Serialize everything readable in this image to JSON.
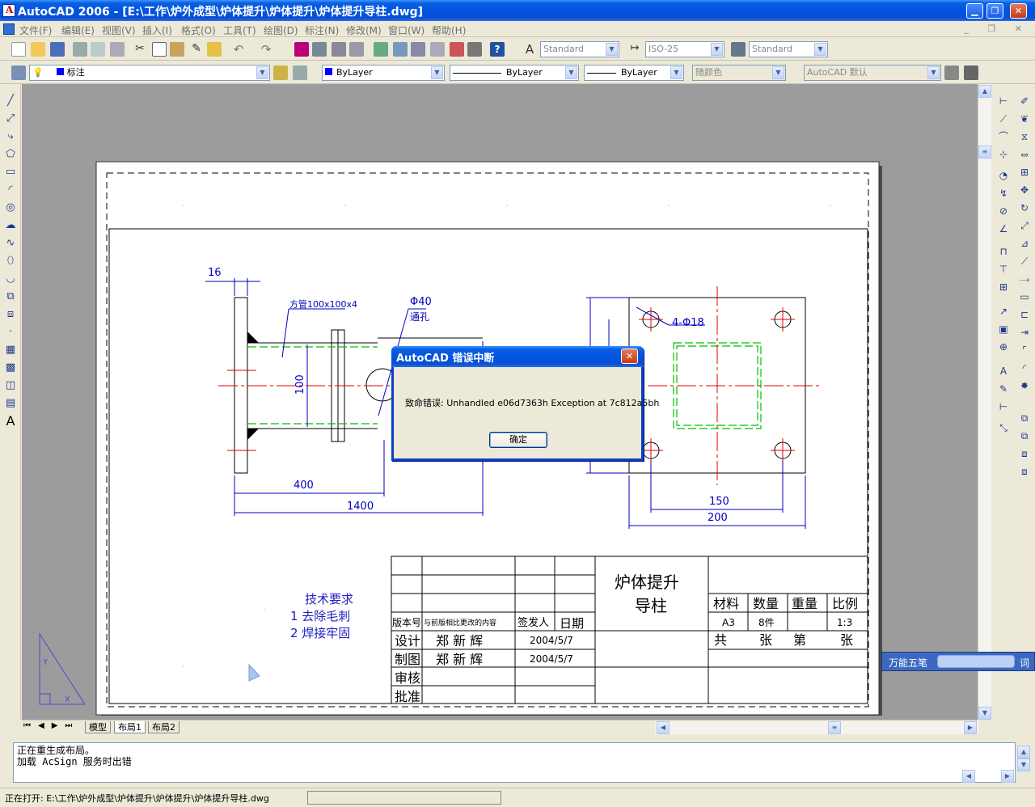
{
  "window": {
    "title": "AutoCAD 2006 - [E:\\工作\\炉外成型\\炉体提升\\炉体提升\\炉体提升导柱.dwg]",
    "controls": [
      "0",
      "1",
      "r"
    ]
  },
  "menu": [
    "文件(F)",
    "编辑(E)",
    "视图(V)",
    "插入(I)",
    "格式(O)",
    "工具(T)",
    "绘图(D)",
    "标注(N)",
    "修改(M)",
    "窗口(W)",
    "帮助(H)"
  ],
  "toolbar1": {
    "text_style": "Standard",
    "dim_style": "ISO-25",
    "table_style": "Standard"
  },
  "toolbar2": {
    "layer": "标注",
    "color": "ByLayer",
    "linetype": "ByLayer",
    "lineweight": "ByLayer",
    "plotstyle": "随颜色",
    "workspace": "AutoCAD 默认"
  },
  "drawing": {
    "dims": {
      "d16": "16",
      "pipe": "方管100x100x4",
      "phi40": "Φ40",
      "through": "通孔",
      "holes": "4-Φ18",
      "d100": "100",
      "d400": "400",
      "d1400": "1400",
      "d150": "150",
      "d200": "200"
    },
    "tech": {
      "title": "技术要求",
      "item1": "1 去除毛刺",
      "item2": "2 焊接牢固"
    },
    "titleblock": {
      "part_name_1": "炉体提升",
      "part_name_2": "导柱",
      "ver": "版本号",
      "changes": "与前版相比更改的内容",
      "issuer": "签发人",
      "date": "日期",
      "design": "设计",
      "draw": "制图",
      "check": "审核",
      "approve": "批准",
      "designer": "郑 新 辉",
      "drafter": "郑 新 辉",
      "date1": "2004/5/7",
      "date2": "2004/5/7",
      "material_h": "材料",
      "qty_h": "数量",
      "weight_h": "重量",
      "scale_h": "比例",
      "material": "A3",
      "qty": "8件",
      "scale": "1:3",
      "total": "共",
      "sheets": "张",
      "no": "第",
      "sheet2": "张"
    }
  },
  "dialog": {
    "title": "AutoCAD 错误中断",
    "message": "致命错误: Unhandled e06d7363h Exception at 7c812a5bh",
    "ok": "确定"
  },
  "tabs": [
    "模型",
    "布局1",
    "布局2"
  ],
  "command": {
    "line1": "正在重生成布局。",
    "line2": "加载 AcSign 服务时出错"
  },
  "status": "正在打开: E:\\工作\\炉外成型\\炉体提升\\炉体提升\\炉体提升导柱.dwg",
  "ime": {
    "label": "万能五笔",
    "word": "词"
  }
}
